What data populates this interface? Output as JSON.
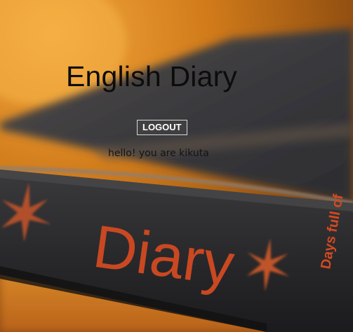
{
  "page": {
    "title": "English Diary",
    "logout_label": "LOGOUT",
    "greeting": "hello! you are kikuta"
  },
  "background": {
    "description_icon": "diary-book-photo",
    "spine_text": "Diary",
    "spine_small_text": "Days full of",
    "colors": {
      "warm_orange": "#d4801f",
      "book_dark": "#3a3a3e",
      "spine_red": "#c84a26"
    }
  }
}
